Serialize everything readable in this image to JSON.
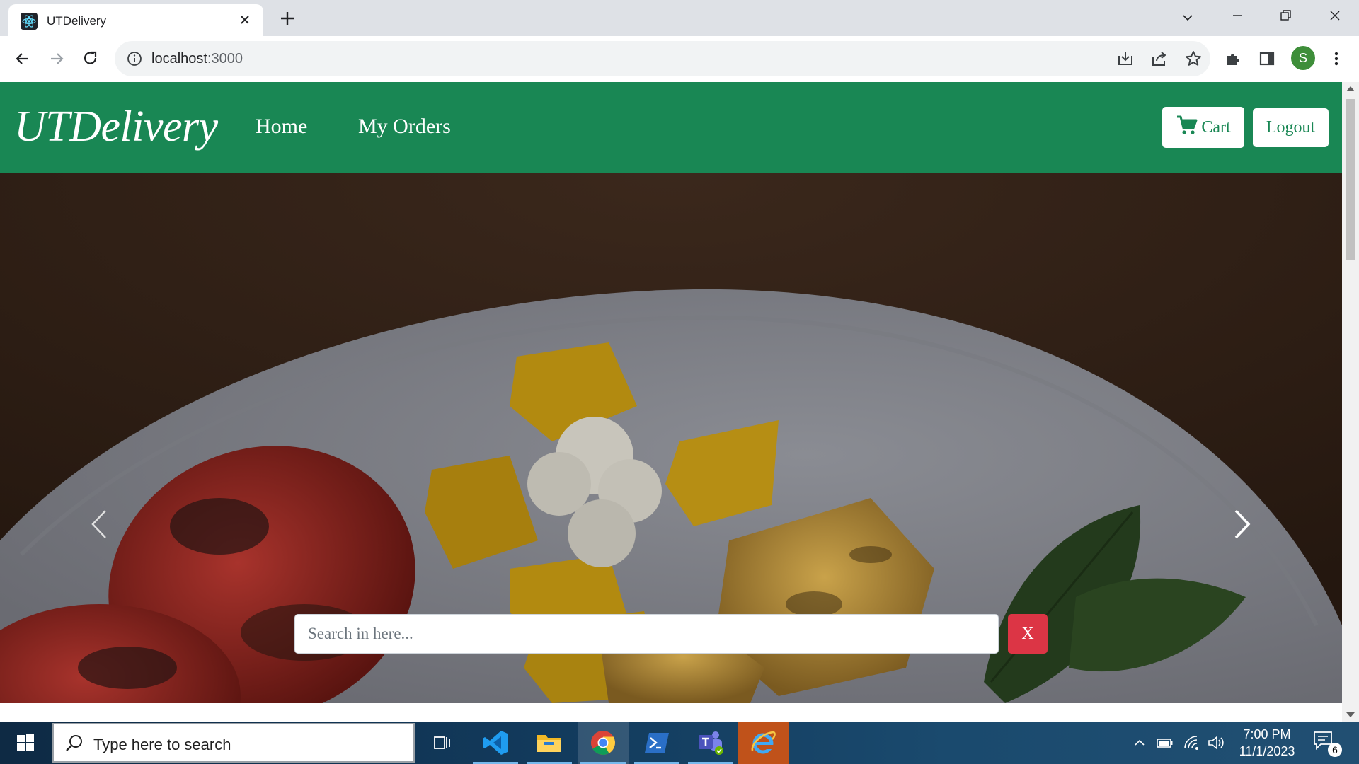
{
  "browser": {
    "tab_title": "UTDelivery",
    "url_host": "localhost",
    "url_port": ":3000"
  },
  "profile_initial": "S",
  "navbar": {
    "brand": "UTDelivery",
    "links": [
      "Home",
      "My Orders"
    ],
    "cart_label": "Cart",
    "logout_label": "Logout"
  },
  "search": {
    "placeholder": "Search in here...",
    "clear_label": "X"
  },
  "taskbar": {
    "search_placeholder": "Type here to search",
    "time": "7:00 PM",
    "date": "11/1/2023",
    "notification_count": "6"
  },
  "colors": {
    "navbar": "#198754",
    "clear_button": "#dc3545",
    "tab_strip": "#dee1e6"
  }
}
